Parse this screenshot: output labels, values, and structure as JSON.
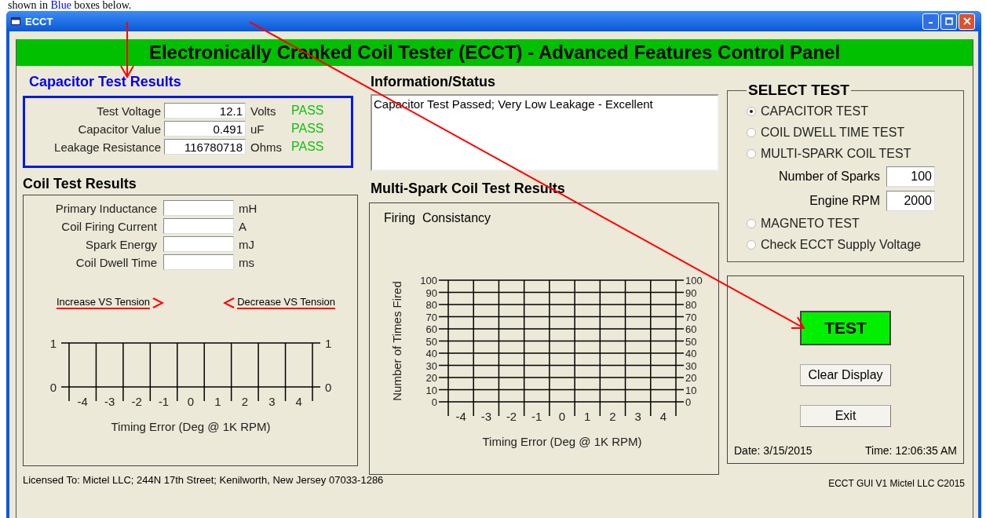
{
  "document_text": [
    {
      "text": "shown in ",
      "highlighted": false
    },
    {
      "text": "Blue",
      "highlighted": true
    },
    {
      "text": " boxes below.",
      "highlighted": false
    }
  ],
  "window": {
    "title": "ECCT"
  },
  "header": "Electronically Cranked Coil Tester (ECCT)  -  Advanced Features Control Panel",
  "capacitor_results": {
    "title": "Capacitor Test Results",
    "rows": [
      {
        "label": "Test Voltage",
        "value": "12.1",
        "unit": "Volts",
        "result": "PASS"
      },
      {
        "label": "Capacitor Value",
        "value": "0.491",
        "unit": "uF",
        "result": "PASS"
      },
      {
        "label": "Leakage Resistance",
        "value": "116780718",
        "unit": "Ohms",
        "result": "PASS"
      }
    ]
  },
  "coil_results": {
    "title": "Coil Test Results",
    "rows": [
      {
        "label": "Primary Inductance",
        "unit": "mH"
      },
      {
        "label": "Coil Firing Current",
        "unit": "A"
      },
      {
        "label": "Spark Energy",
        "unit": "mJ"
      },
      {
        "label": "Coil Dwell Time",
        "unit": "ms"
      }
    ],
    "increase_label": "Increase VS Tension",
    "decrease_label": "Decrease VS Tension",
    "chart_data": {
      "type": "bar",
      "xlabel": "Timing Error (Deg @ 1K RPM)",
      "categories": [
        "-4",
        "-3",
        "-2",
        "-1",
        "0",
        "1",
        "2",
        "3",
        "4"
      ],
      "values": [
        null,
        null,
        null,
        null,
        null,
        null,
        null,
        null,
        null
      ],
      "ylim": [
        0,
        1
      ],
      "yticks": [
        0,
        1
      ],
      "y2ticks": [
        0,
        1
      ],
      "y2lim": [
        0,
        1
      ],
      "grid": true
    }
  },
  "information_status": {
    "title": "Information/Status",
    "text": "Capacitor Test Passed; Very Low Leakage - Excellent"
  },
  "multi_spark_results": {
    "title": "Multi-Spark Coil Test Results",
    "chart_data": {
      "type": "bar",
      "title": "Firing  Consistancy",
      "xlabel": "Timing Error (Deg @ 1K RPM)",
      "ylabel": "Number of Times Fired",
      "categories": [
        "-4",
        "-3",
        "-2",
        "-1",
        "0",
        "1",
        "2",
        "3",
        "4"
      ],
      "values": [
        null,
        null,
        null,
        null,
        null,
        null,
        null,
        null,
        null
      ],
      "ylim": [
        0,
        100
      ],
      "yticks": [
        0,
        10,
        20,
        30,
        40,
        50,
        60,
        70,
        80,
        90,
        100
      ],
      "y2ticks": [
        0,
        10,
        20,
        30,
        40,
        50,
        60,
        70,
        80,
        90,
        100
      ],
      "y2lim": [
        0,
        100
      ],
      "grid": true
    }
  },
  "select_test": {
    "title": "SELECT TEST",
    "options": [
      {
        "kind": "radio",
        "label": "CAPACITOR TEST",
        "selected": true
      },
      {
        "kind": "radio",
        "label": "COIL DWELL TIME TEST",
        "selected": false
      },
      {
        "kind": "radio",
        "label": "MULTI-SPARK COIL TEST",
        "selected": false
      },
      {
        "kind": "field",
        "label": "Number of Sparks",
        "value": "100"
      },
      {
        "kind": "field",
        "label": "Engine RPM",
        "value": "2000"
      },
      {
        "kind": "radio",
        "label": "MAGNETO TEST",
        "selected": false
      },
      {
        "kind": "radio",
        "label": "Check ECCT Supply Voltage",
        "selected": false
      }
    ]
  },
  "buttons": [
    {
      "kind": "primary",
      "label": "TEST"
    },
    {
      "kind": "normal",
      "label": "Clear Display"
    },
    {
      "kind": "normal",
      "label": "Exit"
    }
  ],
  "date": "Date:  3/15/2015",
  "time": "Time: 12:06:35 AM",
  "license": "Licensed To:  Mictel LLC; 244N 17th Street; Kenilworth, New Jersey 07033-1286",
  "version": "ECCT GUI V1  Mictel LLC C2015"
}
